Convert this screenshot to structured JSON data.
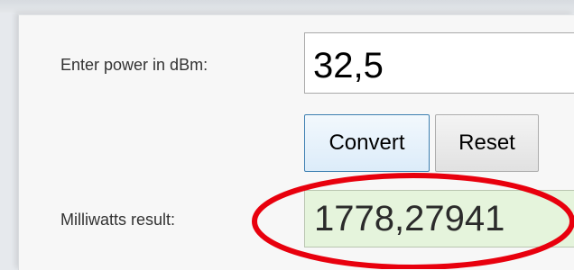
{
  "form": {
    "power_label": "Enter power in dBm:",
    "power_value": "32,5",
    "convert_label": "Convert",
    "reset_label": "Reset",
    "result_label": "Milliwatts result:",
    "result_value": "1778,27941"
  },
  "colors": {
    "result_background": "#e5f4dc",
    "highlight_ring": "#e8000d",
    "convert_border": "#3c7fb1"
  }
}
